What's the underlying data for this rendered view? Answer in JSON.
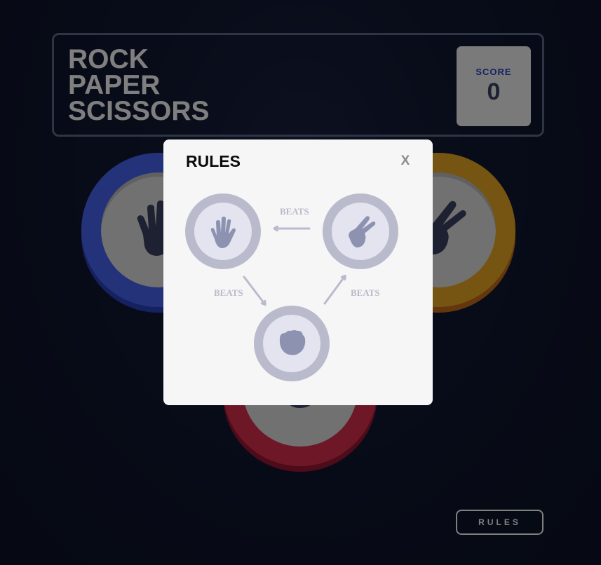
{
  "header": {
    "title_lines": [
      "ROCK",
      "PAPER",
      "SCISSORS"
    ],
    "score_label": "SCORE",
    "score_value": "0"
  },
  "tokens": [
    {
      "id": "paper",
      "color": "#4865f4"
    },
    {
      "id": "scissors",
      "color": "#eca922"
    },
    {
      "id": "rock",
      "color": "#dc2e4e"
    }
  ],
  "footer": {
    "rules_button_label": "RULES"
  },
  "modal": {
    "title": "RULES",
    "close_label": "X",
    "beats_labels": {
      "scissors_beats_paper": "BEATS",
      "paper_beats_rock": "BEATS",
      "rock_beats_scissors": "BEATS"
    }
  },
  "colors": {
    "background": "#101831",
    "header_border": "#5e6a85",
    "modal_bg": "#f6f6f6",
    "diagram_ring": "#b9bbcc",
    "diagram_inner": "#e3e4ef",
    "diagram_icon": "#8d92b0"
  }
}
